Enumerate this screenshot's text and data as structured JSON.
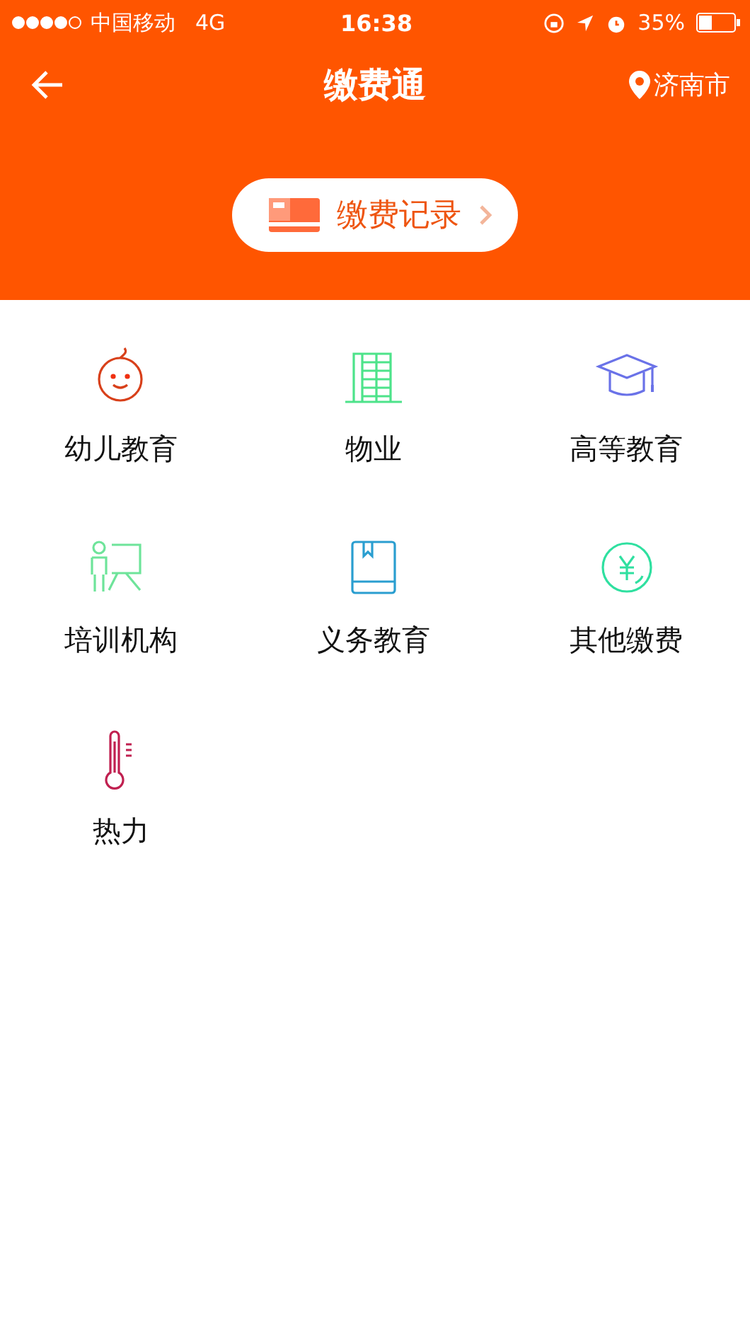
{
  "status_bar": {
    "carrier": "中国移动",
    "network": "4G",
    "time": "16:38",
    "battery": "35%"
  },
  "nav": {
    "title": "缴费通",
    "city": "济南市"
  },
  "record_button": {
    "label": "缴费记录"
  },
  "categories": [
    {
      "label": "幼儿教育",
      "kind": "baby"
    },
    {
      "label": "物业",
      "kind": "building"
    },
    {
      "label": "高等教育",
      "kind": "cap"
    },
    {
      "label": "培训机构",
      "kind": "teacher"
    },
    {
      "label": "义务教育",
      "kind": "book"
    },
    {
      "label": "其他缴费",
      "kind": "yuan"
    },
    {
      "label": "热力",
      "kind": "thermometer"
    }
  ]
}
